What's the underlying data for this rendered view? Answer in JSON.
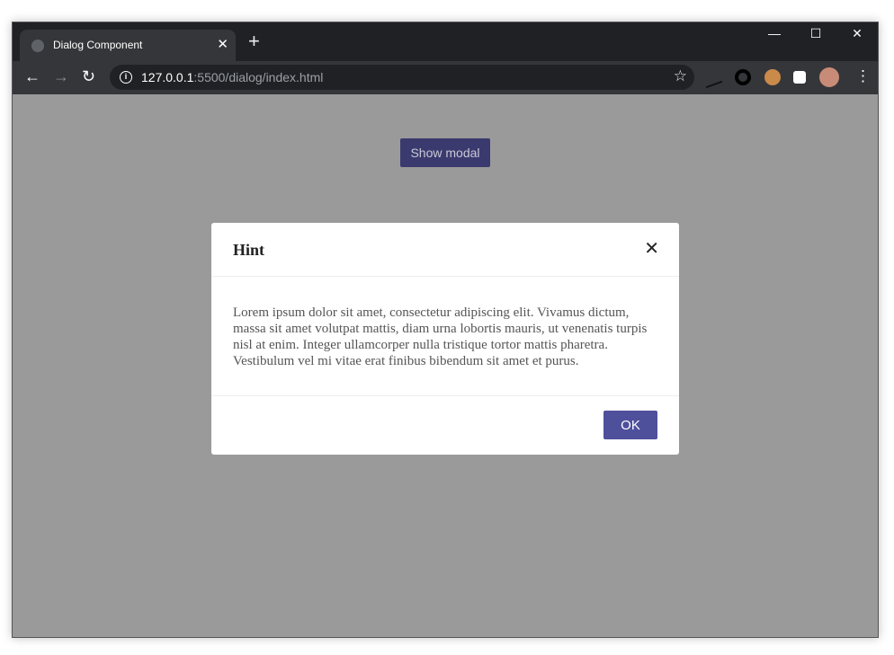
{
  "browser": {
    "tab_title": "Dialog Component",
    "url_host": "127.0.0.1",
    "url_rest": ":5500/dialog/index.html",
    "new_tab": "+",
    "close_tab": "✕",
    "minimize": "—",
    "maximize": "☐",
    "close_window": "✕",
    "back": "←",
    "forward": "→",
    "reload": "↻",
    "bookmark": "☆",
    "menu": "⋮"
  },
  "page": {
    "show_modal_label": "Show modal"
  },
  "modal": {
    "title": "Hint",
    "close": "✕",
    "body": "Lorem ipsum dolor sit amet, consectetur adipiscing elit. Vivamus dictum, massa sit amet volutpat mattis, diam urna lobortis mauris, ut venenatis turpis nisl at enim. Integer ullamcorper nulla tristique tortor mattis pharetra. Vestibulum vel mi vitae erat finibus bibendum sit amet et purus.",
    "ok_label": "OK"
  },
  "colors": {
    "overlay": "#9a9a9a",
    "primary_button": "#4f509c",
    "show_button": "#3b3a6e"
  }
}
